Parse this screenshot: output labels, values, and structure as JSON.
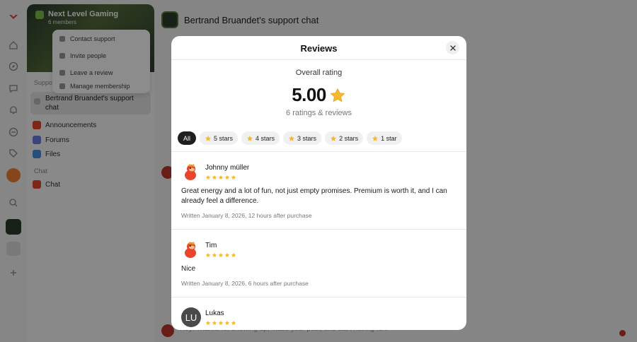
{
  "background": {
    "community": {
      "name": "Next Level Gaming",
      "subtitle": "6 members"
    },
    "context_menu": [
      "Contact support",
      "Invite people",
      "Leave a review",
      "Manage membership"
    ],
    "sections": {
      "support_label": "Support",
      "chat_label": "Chat"
    },
    "active_channel": "Bertrand Bruandet's support chat",
    "channels": [
      "Announcements",
      "Forums",
      "Files"
    ],
    "chat_channel": "Chat",
    "chat_header_title": "Bertrand Bruandet's support chat",
    "bottom_message": "Hey! Thanks for showing up, made your post, and start having fun!"
  },
  "modal": {
    "title": "Reviews",
    "overall_label": "Overall rating",
    "score": "5.00",
    "count_text": "6 ratings & reviews",
    "filters": [
      {
        "label": "All",
        "star": false,
        "active": true
      },
      {
        "label": "5 stars",
        "star": true,
        "active": false
      },
      {
        "label": "4 stars",
        "star": true,
        "active": false
      },
      {
        "label": "3 stars",
        "star": true,
        "active": false
      },
      {
        "label": "2 stars",
        "star": true,
        "active": false
      },
      {
        "label": "1 star",
        "star": true,
        "active": false
      }
    ],
    "reviews": [
      {
        "name": "Johnny müller",
        "avatar": "mascot",
        "rating": 5,
        "body": "Great energy and a lot of fun, not just empty promises. Premium is worth it, and I can already feel a difference.",
        "meta": "Written January 8, 2026, 12 hours after purchase"
      },
      {
        "name": "Tim",
        "avatar": "mascot",
        "rating": 5,
        "body": "Nice",
        "meta": "Written January 8, 2026, 6 hours after purchase"
      },
      {
        "name": "Lukas",
        "avatar": "initials",
        "initials": "LU",
        "rating": 5
      }
    ]
  },
  "colors": {
    "star": "#F5B82E",
    "chip_active": "#1F1F1F",
    "brand_red": "#E8452C"
  }
}
